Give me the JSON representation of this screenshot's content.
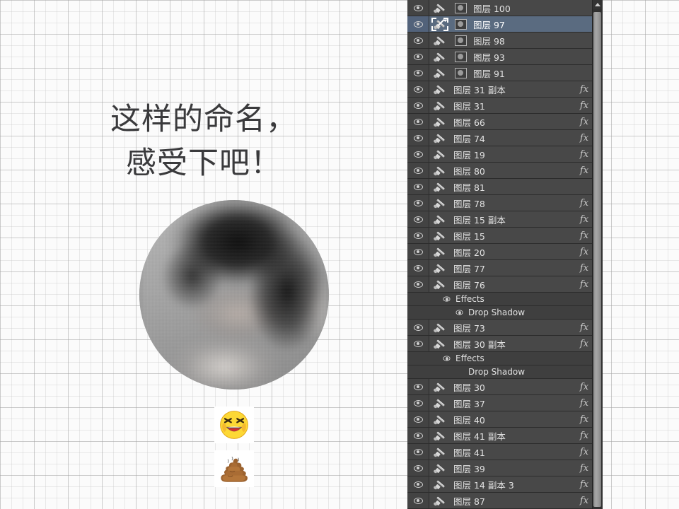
{
  "canvas": {
    "headline": "这样的命名，\n感受下吧！",
    "photo_alt": "blurred-portrait",
    "stickers": [
      {
        "name": "face-with-tears-of-joy-emoji",
        "glyph": "😂"
      },
      {
        "name": "pile-of-poo-emoji",
        "glyph": "💩"
      }
    ]
  },
  "layers_panel": {
    "fx_label": "fx",
    "scrollbar": {
      "up_arrow": "▲"
    },
    "rows": [
      {
        "name": "图层 100",
        "type": "layer",
        "visible": true,
        "thumb": "circle",
        "fx": false,
        "expand": "none",
        "selected": false
      },
      {
        "name": "图层 97",
        "type": "layer",
        "visible": true,
        "thumb": "circle",
        "fx": false,
        "expand": "none",
        "selected": true
      },
      {
        "name": "图层 98",
        "type": "layer",
        "visible": true,
        "thumb": "circle",
        "fx": false,
        "expand": "none",
        "selected": false
      },
      {
        "name": "图层 93",
        "type": "layer",
        "visible": true,
        "thumb": "circle",
        "fx": false,
        "expand": "none",
        "selected": false
      },
      {
        "name": "图层 91",
        "type": "layer",
        "visible": true,
        "thumb": "circle",
        "fx": false,
        "expand": "none",
        "selected": false
      },
      {
        "name": "图层 31 副本",
        "type": "layer",
        "visible": true,
        "thumb": "none",
        "fx": true,
        "expand": "down",
        "selected": false
      },
      {
        "name": "图层 31",
        "type": "layer",
        "visible": true,
        "thumb": "none",
        "fx": true,
        "expand": "down",
        "selected": false
      },
      {
        "name": "图层 66",
        "type": "layer",
        "visible": true,
        "thumb": "none",
        "fx": true,
        "expand": "down",
        "selected": false
      },
      {
        "name": "图层 74",
        "type": "layer",
        "visible": true,
        "thumb": "none",
        "fx": true,
        "expand": "down",
        "selected": false
      },
      {
        "name": "图层 19",
        "type": "layer",
        "visible": true,
        "thumb": "none",
        "fx": true,
        "expand": "down",
        "selected": false
      },
      {
        "name": "图层 80",
        "type": "layer",
        "visible": true,
        "thumb": "none",
        "fx": true,
        "expand": "down",
        "selected": false
      },
      {
        "name": "图层 81",
        "type": "layer",
        "visible": true,
        "thumb": "none",
        "fx": false,
        "expand": "blank",
        "selected": false
      },
      {
        "name": "图层 78",
        "type": "layer",
        "visible": true,
        "thumb": "none",
        "fx": true,
        "expand": "down",
        "selected": false
      },
      {
        "name": "图层 15 副本",
        "type": "layer",
        "visible": true,
        "thumb": "none",
        "fx": true,
        "expand": "down",
        "selected": false
      },
      {
        "name": "图层 15",
        "type": "layer",
        "visible": true,
        "thumb": "none",
        "fx": true,
        "expand": "down",
        "selected": false
      },
      {
        "name": "图层 20",
        "type": "layer",
        "visible": true,
        "thumb": "none",
        "fx": true,
        "expand": "down",
        "selected": false
      },
      {
        "name": "图层 77",
        "type": "layer",
        "visible": true,
        "thumb": "none",
        "fx": true,
        "expand": "down",
        "selected": false
      },
      {
        "name": "图层 76",
        "type": "layer",
        "visible": true,
        "thumb": "none",
        "fx": true,
        "expand": "up",
        "selected": false
      },
      {
        "name": "Effects",
        "type": "effects-group",
        "visible": true,
        "indent": 1
      },
      {
        "name": "Drop Shadow",
        "type": "effect",
        "visible": true,
        "indent": 2
      },
      {
        "name": "图层 73",
        "type": "layer",
        "visible": true,
        "thumb": "none",
        "fx": true,
        "expand": "down",
        "selected": false
      },
      {
        "name": "图层 30 副本",
        "type": "layer",
        "visible": true,
        "thumb": "none",
        "fx": true,
        "expand": "up",
        "selected": false
      },
      {
        "name": "Effects",
        "type": "effects-group",
        "visible": true,
        "indent": 1
      },
      {
        "name": "Drop Shadow",
        "type": "effect",
        "visible": false,
        "indent": 2
      },
      {
        "name": "图层 30",
        "type": "layer",
        "visible": true,
        "thumb": "none",
        "fx": true,
        "expand": "down",
        "selected": false
      },
      {
        "name": "图层 37",
        "type": "layer",
        "visible": true,
        "thumb": "none",
        "fx": true,
        "expand": "down",
        "selected": false
      },
      {
        "name": "图层 40",
        "type": "layer",
        "visible": true,
        "thumb": "none",
        "fx": true,
        "expand": "down",
        "selected": false
      },
      {
        "name": "图层 41 副本",
        "type": "layer",
        "visible": true,
        "thumb": "none",
        "fx": true,
        "expand": "down",
        "selected": false
      },
      {
        "name": "图层 41",
        "type": "layer",
        "visible": true,
        "thumb": "none",
        "fx": true,
        "expand": "down",
        "selected": false
      },
      {
        "name": "图层 39",
        "type": "layer",
        "visible": true,
        "thumb": "none",
        "fx": true,
        "expand": "down",
        "selected": false
      },
      {
        "name": "图层 14 副本 3",
        "type": "layer",
        "visible": true,
        "thumb": "none",
        "fx": true,
        "expand": "down",
        "selected": false
      },
      {
        "name": "图层 87",
        "type": "layer",
        "visible": true,
        "thumb": "none",
        "fx": true,
        "expand": "down",
        "selected": false
      }
    ]
  },
  "colors": {
    "panel_bg": "#3b3b3b",
    "row_bg": "#484848",
    "row_selected": "#5a6b80",
    "text": "#e2e2e2",
    "canvas_bg": "#fbfbfb"
  }
}
